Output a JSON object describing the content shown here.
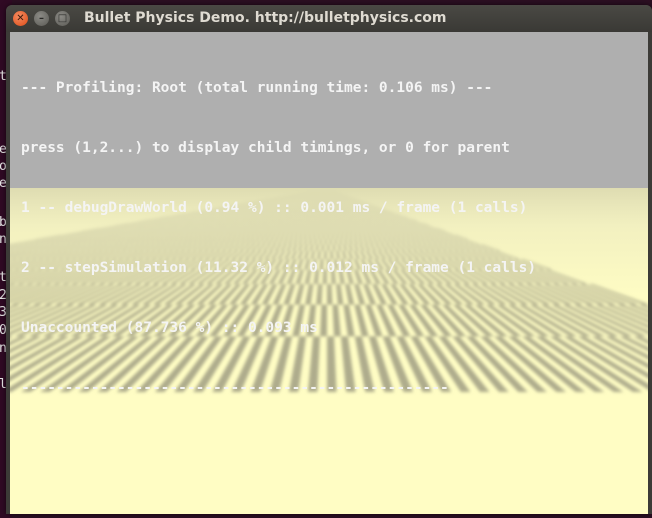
{
  "background_terminal": {
    "lines": [
      "t",
      "e",
      "o",
      "e",
      "b",
      "n",
      "t",
      "2",
      "3",
      "0",
      "n",
      "l"
    ]
  },
  "window": {
    "title": "Bullet Physics Demo. http://bulletphysics.com",
    "close_glyph": "✕",
    "minimize_glyph": "–",
    "maximize_glyph": "□"
  },
  "profiler": {
    "header": "--- Profiling: Root (total running time: 0.106 ms) ---",
    "instructions": "press (1,2...) to display child timings, or 0 for parent",
    "entries": [
      "1 -- debugDrawWorld (0.94 %) :: 0.001 ms / frame (1 calls)",
      "2 -- stepSimulation (11.32 %) :: 0.012 ms / frame (1 calls)"
    ],
    "unaccounted": "Unaccounted (87.736 %) :: 0.093 ms",
    "separator": "-------------------------------------------------"
  },
  "colors": {
    "sky": "#afafaf",
    "tile_light": "#fffdc4",
    "tile_dark": "#aeac8c",
    "title_bar": "#3c3b37",
    "close_button": "#df4b16",
    "desktop_terminal": "#300a24"
  }
}
